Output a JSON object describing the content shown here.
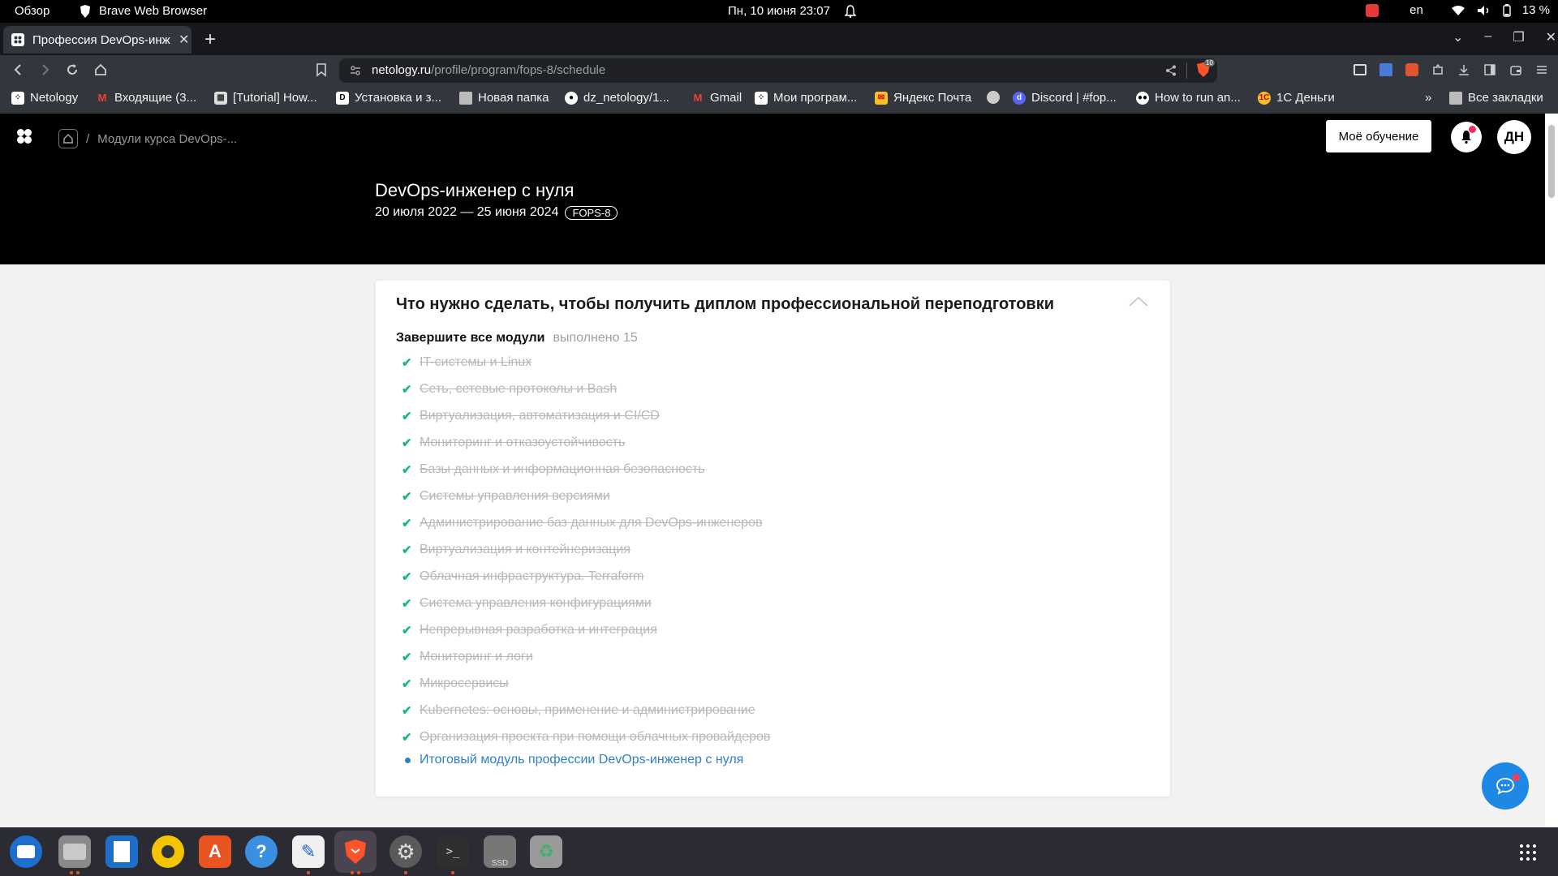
{
  "system": {
    "activities": "Обзор",
    "app_name": "Brave Web Browser",
    "datetime": "Пн, 10 июня  23:07",
    "lang": "en",
    "battery": "13 %"
  },
  "browser": {
    "tab_title": "Профессия DevOps-инж",
    "url_host": "netology.ru",
    "url_path": "/profile/program/fops-8/schedule",
    "shield_count": "10",
    "bookmarks": [
      "Netology",
      "Входящие (3...",
      "[Tutorial] How...",
      "Установка и з...",
      "Новая папка",
      "dz_netology/1...",
      "Gmail",
      "Мои програм...",
      "Яндекс Почта",
      "",
      "Discord | #fop...",
      "How to run an...",
      "1С Деньги"
    ],
    "more_bookmarks": "»",
    "all_bookmarks": "Все закладки"
  },
  "page": {
    "breadcrumb": "Модули курса DevOps-...",
    "my_learning": "Моё обучение",
    "avatar": "ДН",
    "course_title": "DevOps-инженер с нуля",
    "course_dates": "20 июля 2022 — 25 июня 2024",
    "course_code": "FOPS-8"
  },
  "card": {
    "title": "Что нужно сделать, чтобы получить диплом профессиональной переподготовки",
    "subtitle": "Завершите все модули",
    "done": "выполнено 15",
    "modules": [
      "IT-системы и Linux",
      "Сеть, сетевые протоколы и Bash",
      "Виртуализация, автоматизация и CI/CD",
      "Мониторинг и отказоустойчивость",
      "Базы данных и информационная безопасность",
      "Системы управления версиями",
      "Администрирование баз данных для DevOps-инженеров",
      "Виртуализация и контейнеризация",
      "Облачная инфраструктура. Terraform",
      "Система управления конфигурациями",
      "Непрерывная разработка и интеграция",
      "Мониторинг и логи",
      "Микросервисы",
      "Kubernetes: основы, применение и администрирование",
      "Организация проекта при помощи облачных провайдеров"
    ],
    "final_module": "Итоговый модуль профессии DevOps-инженер с нуля"
  },
  "dock": {
    "ssd_label": "SSD"
  },
  "colors": {
    "accent_blue": "#2f80c7",
    "check_green": "#1cb87a",
    "header_bg": "#000000",
    "notification_dot": "#ef2f5b"
  }
}
